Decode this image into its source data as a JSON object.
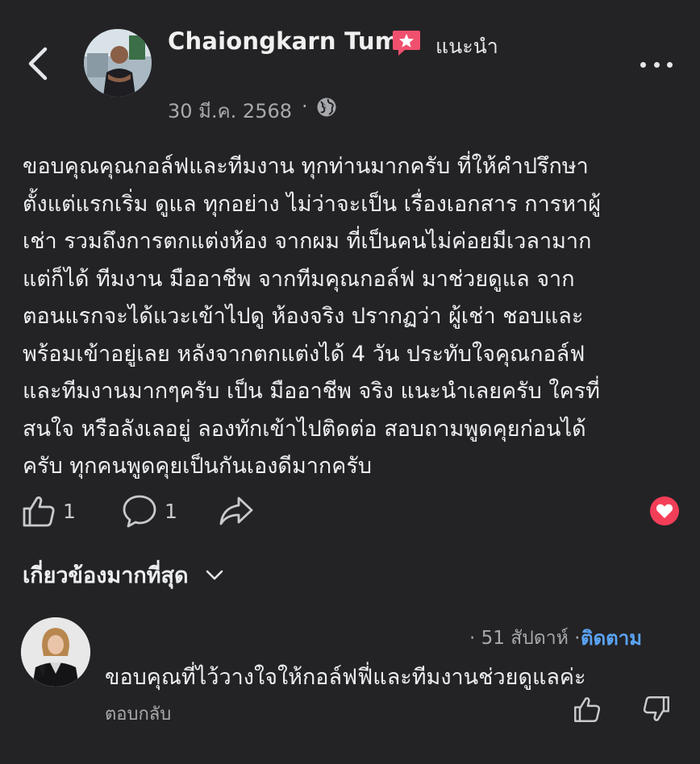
{
  "header": {
    "author_name": "Chaiongkarn Tum",
    "recommend_label": "แนะนำ",
    "post_date": "30 มี.ค. 2568",
    "separator": "·",
    "icons": {
      "back": "chevron-left-icon",
      "badge": "recommend-star-badge-icon",
      "more": "more-horizontal-icon",
      "privacy": "globe-icon"
    }
  },
  "post": {
    "lines": [
      "ขอบคุณคุณกอล์ฟและทีมงาน ทุกท่านมากครับ ที่ให้คำปรึกษา",
      "ตั้งแต่แรกเริ่ม ดูแล ทุกอย่าง ไม่ว่าจะเป็น เรื่องเอกสาร การหาผู้",
      "เช่า รวมถึงการตกแต่งห้อง จากผม ที่เป็นคนไม่ค่อยมีเวลามาก",
      "แต่ก็ได้ ทีมงาน มืออาชีพ จากทีมคุณกอล์ฟ มาช่วยดูแล จาก",
      "ตอนแรกจะได้แวะเข้าไปดู ห้องจริง ปรากฏว่า ผู้เช่า ชอบและ",
      "พร้อมเข้าอยู่เลย หลังจากตกแต่งได้ 4 วัน ประทับใจคุณกอล์ฟ",
      "และทีมงานมากๆครับ เป็น มืออาชีพ จริง แนะนำเลยครับ ใครที่",
      "สนใจ หรือลังเลอยู่ ลองทักเข้าไปติดต่อ สอบถามพูดคุยก่อนได้",
      "ครับ ทุกคนพูดคุยเป็นกันเองดีมากครับ"
    ]
  },
  "actions": {
    "like_count": "1",
    "comment_count": "1",
    "reaction_color": "#f33e58"
  },
  "comments_section": {
    "sort_label": "เกี่ยวข้องมากที่สุด",
    "comment": {
      "timestamp": "· 51 สัปดาห์ ·",
      "follow_label": "ติดตาม",
      "text": "ขอบคุณที่ไว้วางใจให้กอล์ฟฟี่และทีมงานช่วยดูแลค่ะ",
      "reply_label": "ตอบกลับ"
    }
  },
  "colors": {
    "background": "#232325",
    "link": "#5aa4f5",
    "badge": "#f0506e"
  }
}
